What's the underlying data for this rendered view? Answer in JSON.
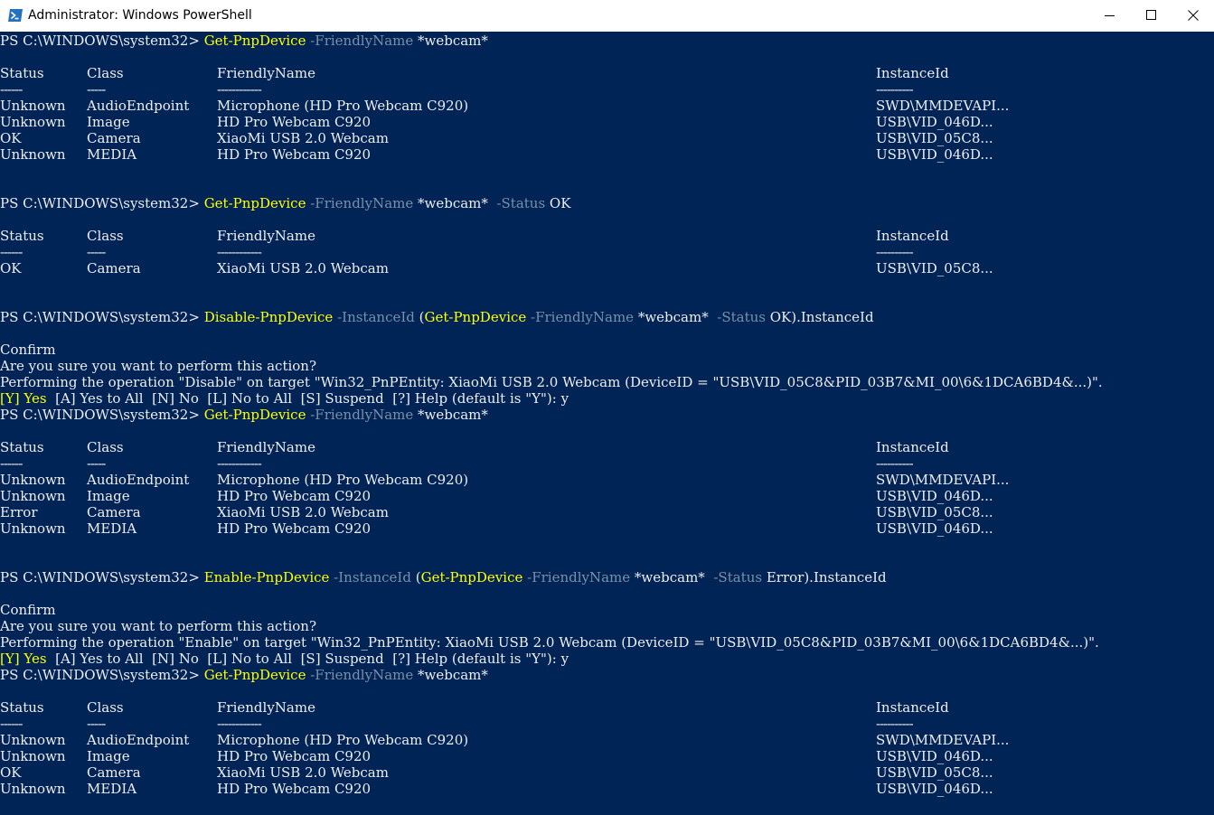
{
  "window": {
    "title": "Administrator: Windows PowerShell",
    "colors": {
      "console_bg": "#012456",
      "console_fg": "#eeedf0",
      "command": "#ffff00",
      "parameter": "#7c8fa8",
      "titlebar_bg": "#ffffff"
    },
    "icons": [
      "powershell-icon",
      "minimize-icon",
      "maximize-icon",
      "close-icon"
    ]
  },
  "prompt": "PS C:\\WINDOWS\\system32> ",
  "commands": [
    [
      {
        "text": "Get-PnpDevice",
        "kind": "cmd"
      },
      {
        "text": " -FriendlyName",
        "kind": "param"
      },
      {
        "text": " *webcam*",
        "kind": "arg"
      }
    ],
    [
      {
        "text": "Get-PnpDevice",
        "kind": "cmd"
      },
      {
        "text": " -FriendlyName",
        "kind": "param"
      },
      {
        "text": " *webcam*",
        "kind": "arg"
      },
      {
        "text": "  -Status",
        "kind": "param"
      },
      {
        "text": " OK",
        "kind": "arg"
      }
    ],
    [
      {
        "text": "Disable-PnpDevice",
        "kind": "cmd"
      },
      {
        "text": " -InstanceId",
        "kind": "param"
      },
      {
        "text": " (",
        "kind": "arg"
      },
      {
        "text": "Get-PnpDevice",
        "kind": "cmd"
      },
      {
        "text": " -FriendlyName",
        "kind": "param"
      },
      {
        "text": " *webcam*",
        "kind": "arg"
      },
      {
        "text": "  -Status",
        "kind": "param"
      },
      {
        "text": " OK).InstanceId",
        "kind": "arg"
      }
    ],
    [
      {
        "text": "Get-PnpDevice",
        "kind": "cmd"
      },
      {
        "text": " -FriendlyName",
        "kind": "param"
      },
      {
        "text": " *webcam*",
        "kind": "arg"
      }
    ],
    [
      {
        "text": "Enable-PnpDevice",
        "kind": "cmd"
      },
      {
        "text": " -InstanceId",
        "kind": "param"
      },
      {
        "text": " (",
        "kind": "arg"
      },
      {
        "text": "Get-PnpDevice",
        "kind": "cmd"
      },
      {
        "text": " -FriendlyName",
        "kind": "param"
      },
      {
        "text": " *webcam*",
        "kind": "arg"
      },
      {
        "text": "  -Status",
        "kind": "param"
      },
      {
        "text": " Error).InstanceId",
        "kind": "arg"
      }
    ],
    [
      {
        "text": "Get-PnpDevice",
        "kind": "cmd"
      },
      {
        "text": " -FriendlyName",
        "kind": "param"
      },
      {
        "text": " *webcam*",
        "kind": "arg"
      }
    ]
  ],
  "table": {
    "headers": [
      "Status",
      "Class",
      "FriendlyName",
      "InstanceId"
    ],
    "underlines": [
      "------",
      "-----",
      "------------",
      "----------"
    ]
  },
  "tables": [
    [
      [
        "Unknown",
        "AudioEndpoint",
        "Microphone (HD Pro Webcam C920)",
        "SWD\\MMDEVAPI..."
      ],
      [
        "Unknown",
        "Image",
        "HD Pro Webcam C920",
        "USB\\VID_046D..."
      ],
      [
        "OK",
        "Camera",
        "XiaoMi USB 2.0 Webcam",
        "USB\\VID_05C8..."
      ],
      [
        "Unknown",
        "MEDIA",
        "HD Pro Webcam C920",
        "USB\\VID_046D..."
      ]
    ],
    [
      [
        "OK",
        "Camera",
        "XiaoMi USB 2.0 Webcam",
        "USB\\VID_05C8..."
      ]
    ],
    [
      [
        "Unknown",
        "AudioEndpoint",
        "Microphone (HD Pro Webcam C920)",
        "SWD\\MMDEVAPI..."
      ],
      [
        "Unknown",
        "Image",
        "HD Pro Webcam C920",
        "USB\\VID_046D..."
      ],
      [
        "Error",
        "Camera",
        "XiaoMi USB 2.0 Webcam",
        "USB\\VID_05C8..."
      ],
      [
        "Unknown",
        "MEDIA",
        "HD Pro Webcam C920",
        "USB\\VID_046D..."
      ]
    ],
    [
      [
        "Unknown",
        "AudioEndpoint",
        "Microphone (HD Pro Webcam C920)",
        "SWD\\MMDEVAPI..."
      ],
      [
        "Unknown",
        "Image",
        "HD Pro Webcam C920",
        "USB\\VID_046D..."
      ],
      [
        "OK",
        "Camera",
        "XiaoMi USB 2.0 Webcam",
        "USB\\VID_05C8..."
      ],
      [
        "Unknown",
        "MEDIA",
        "HD Pro Webcam C920",
        "USB\\VID_046D..."
      ]
    ]
  ],
  "confirms": [
    {
      "title": "Confirm",
      "question": "Are you sure you want to perform this action?",
      "detail": "Performing the operation \"Disable\" on target \"Win32_PnPEntity: XiaoMi USB 2.0 Webcam (DeviceID = \"USB\\VID_05C8&PID_03B7&MI_00\\6&1DCA6BD4&...)\".",
      "yes_option": "[Y] Yes",
      "other_options": "  [A] Yes to All  [N] No  [L] No to All  [S] Suspend  [?] Help (default is \"Y\"): y"
    },
    {
      "title": "Confirm",
      "question": "Are you sure you want to perform this action?",
      "detail": "Performing the operation \"Enable\" on target \"Win32_PnPEntity: XiaoMi USB 2.0 Webcam (DeviceID = \"USB\\VID_05C8&PID_03B7&MI_00\\6&1DCA6BD4&...)\".",
      "yes_option": "[Y] Yes",
      "other_options": "  [A] Yes to All  [N] No  [L] No to All  [S] Suspend  [?] Help (default is \"Y\"): y"
    }
  ]
}
